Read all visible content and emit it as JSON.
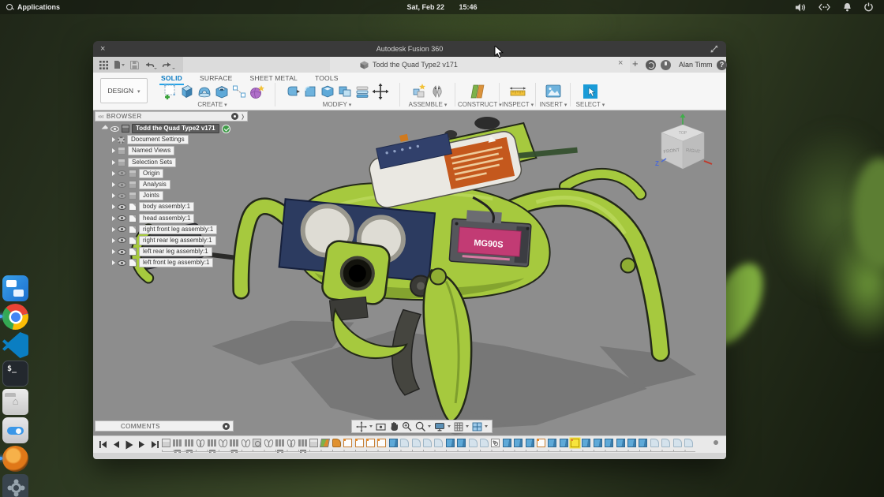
{
  "colors": {
    "accent_blue": "#0696d7",
    "tab_underline": "#22a3e8",
    "model_lime": "#a6c93e",
    "selected_yellow": "#f7e43c",
    "viewport_grey": "#8d8d8d",
    "servo_pink": "#c23b74"
  },
  "top_bar": {
    "applications": "Applications",
    "date": "Sat, Feb 22",
    "time": "15:46",
    "tray": [
      "volume",
      "network",
      "notifications",
      "power"
    ]
  },
  "dock": {
    "items": [
      {
        "id": "multitasking",
        "running": false
      },
      {
        "id": "chrome",
        "running": true
      },
      {
        "id": "vscode",
        "running": true
      },
      {
        "id": "terminal",
        "running": false
      },
      {
        "id": "files",
        "running": false
      },
      {
        "id": "switchboard",
        "running": false
      },
      {
        "id": "orange-app",
        "running": true
      },
      {
        "id": "system-gear",
        "running": false
      }
    ]
  },
  "window": {
    "title": "Autodesk Fusion 360",
    "doc_tab": "Todd the Quad Type2 v171",
    "user": "Alan Timm"
  },
  "ribbon": {
    "design_label": "DESIGN",
    "tabs": [
      {
        "label": "SOLID",
        "active": true
      },
      {
        "label": "SURFACE",
        "active": false
      },
      {
        "label": "SHEET METAL",
        "active": false
      },
      {
        "label": "TOOLS",
        "active": false
      }
    ],
    "groups": [
      "CREATE",
      "MODIFY",
      "ASSEMBLE",
      "CONSTRUCT",
      "INSPECT",
      "INSERT",
      "SELECT"
    ]
  },
  "browser": {
    "header": "BROWSER",
    "root": {
      "label": "Todd the Quad Type2 v171"
    },
    "items": [
      {
        "label": "Document Settings",
        "icon": "gear",
        "eye": "none",
        "dim": false
      },
      {
        "label": "Named Views",
        "icon": "folder",
        "eye": "none",
        "dim": false
      },
      {
        "label": "Selection Sets",
        "icon": "folder",
        "eye": "none",
        "dim": false
      },
      {
        "label": "Origin",
        "icon": "folder",
        "eye": "dim",
        "dim": true
      },
      {
        "label": "Analysis",
        "icon": "folder",
        "eye": "dim",
        "dim": true
      },
      {
        "label": "Joints",
        "icon": "folder",
        "eye": "dim",
        "dim": true
      },
      {
        "label": "body assembly:1",
        "icon": "component",
        "eye": "on",
        "dim": false
      },
      {
        "label": "head assembly:1",
        "icon": "component",
        "eye": "on",
        "dim": false
      },
      {
        "label": "right front leg assembly:1",
        "icon": "component",
        "eye": "on",
        "dim": false
      },
      {
        "label": "right rear leg assembly:1",
        "icon": "component",
        "eye": "on",
        "dim": false
      },
      {
        "label": "left rear leg assembly:1",
        "icon": "component",
        "eye": "on",
        "dim": false
      },
      {
        "label": "left front leg assembly:1",
        "icon": "component",
        "eye": "on",
        "dim": false
      }
    ]
  },
  "viewport": {
    "viewcube": {
      "top": "TOP",
      "front": "FRONT",
      "right": "RIGHT",
      "axis_z": "Z"
    },
    "model_label": "MG90S"
  },
  "comments": {
    "label": "COMMENTS"
  },
  "navbar": {
    "tools": [
      "orbit",
      "look-at",
      "pan",
      "zoom",
      "fit",
      "display-settings",
      "grid-snap",
      "viewports"
    ]
  },
  "timeline": {
    "selected_index": 36,
    "items": [
      {
        "t": "cube",
        "m": false
      },
      {
        "t": "comp",
        "m": true
      },
      {
        "t": "comp",
        "m": true
      },
      {
        "t": "joint",
        "m": false
      },
      {
        "t": "comp",
        "m": true
      },
      {
        "t": "joint",
        "m": false
      },
      {
        "t": "comp",
        "m": true
      },
      {
        "t": "joint",
        "m": false
      },
      {
        "t": "cubealt",
        "m": false
      },
      {
        "t": "joint",
        "m": false
      },
      {
        "t": "comp",
        "m": true
      },
      {
        "t": "joint",
        "m": false
      },
      {
        "t": "comp",
        "m": true
      },
      {
        "t": "cube",
        "m": false
      },
      {
        "t": "plane",
        "m": false
      },
      {
        "t": "form",
        "m": false
      },
      {
        "t": "sketch",
        "m": false
      },
      {
        "t": "sketch",
        "m": false
      },
      {
        "t": "sketch",
        "m": false
      },
      {
        "t": "sketch",
        "m": false
      },
      {
        "t": "extrude",
        "m": false
      },
      {
        "t": "fillet",
        "m": false
      },
      {
        "t": "fillet",
        "m": false
      },
      {
        "t": "fillet",
        "m": false
      },
      {
        "t": "fillet",
        "m": false
      },
      {
        "t": "extrude",
        "m": false
      },
      {
        "t": "extrude",
        "m": false
      },
      {
        "t": "fillet",
        "m": false
      },
      {
        "t": "fillet",
        "m": false
      },
      {
        "t": "link",
        "m": false
      },
      {
        "t": "extrude",
        "m": false
      },
      {
        "t": "extrude",
        "m": false
      },
      {
        "t": "extrude",
        "m": false
      },
      {
        "t": "sketch",
        "m": false
      },
      {
        "t": "extrude",
        "m": false
      },
      {
        "t": "extrude",
        "m": false
      },
      {
        "t": "sketch",
        "m": false
      },
      {
        "t": "extrude",
        "m": false
      },
      {
        "t": "extrude",
        "m": false
      },
      {
        "t": "extrude",
        "m": false
      },
      {
        "t": "extrude",
        "m": false
      },
      {
        "t": "extrude",
        "m": false
      },
      {
        "t": "extrude",
        "m": false
      },
      {
        "t": "fillet",
        "m": false
      },
      {
        "t": "fillet",
        "m": false
      },
      {
        "t": "fillet",
        "m": false
      },
      {
        "t": "fillet",
        "m": false
      }
    ]
  }
}
